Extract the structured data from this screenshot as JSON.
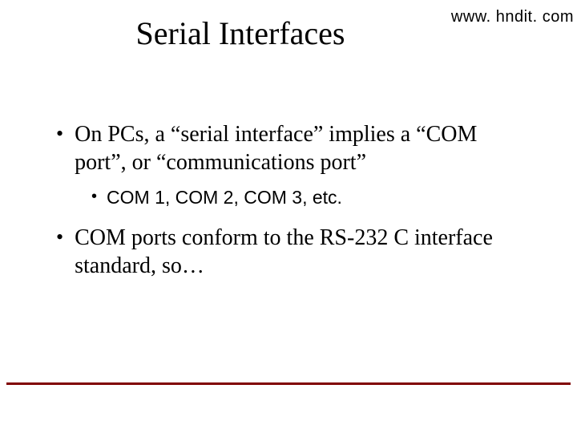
{
  "watermark": "www. hndit. com",
  "title": "Serial Interfaces",
  "bullets": {
    "b1": "On PCs, a “serial interface” implies a “COM port”, or “communications port”",
    "b1_sub1": "COM 1, COM 2, COM 3, etc.",
    "b2": "COM ports conform to the RS-232 C interface standard, so…"
  },
  "colors": {
    "footer_line": "#800000"
  }
}
